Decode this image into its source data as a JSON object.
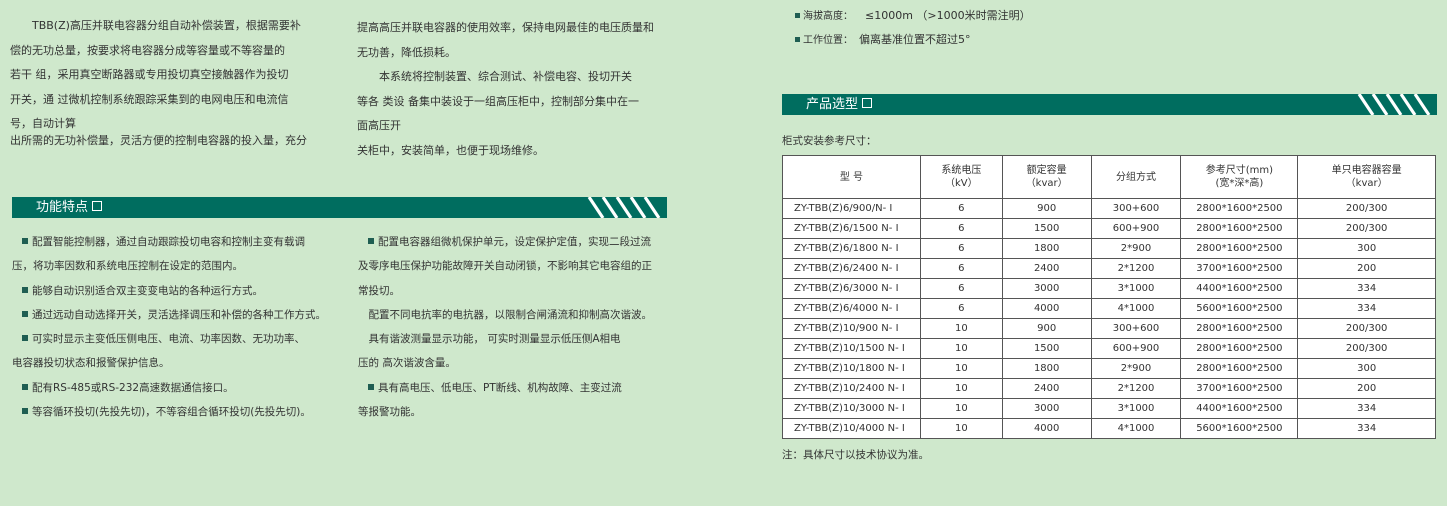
{
  "intro_left": [
    "　　TBB(Z)高压并联电容器分组自动补偿装置，根据需要补",
    "偿的无功总量，按要求将电容器分成等容量或不等容量的",
    "若干 组，采用真空断路器或专用投切真空接触器作为投切",
    "开关，通 过微机控制系统跟踪采集到的电网电压和电流信",
    "号，自动计算",
    "出所需的无功补偿量，灵活方便的控制电容器的投入量，充分"
  ],
  "intro_right": [
    "提高高压并联电容器的使用效率，保持电网最佳的电压质量和",
    "无功善，降低损耗。",
    "　　本系统将控制装置、综合测试、补偿电容、投切开关",
    "等各 类设 备集中装设于一组高压柜中，控制部分集中在一",
    "面高压开",
    "关柜中，安装简单，也便于现场维修。"
  ],
  "env": [
    {
      "label": "海拔高度：",
      "value": "≤1000m （>1000米时需注明）"
    },
    {
      "label": "工作位置：",
      "value": "偏离基准位置不超过5°"
    }
  ],
  "features_banner": {
    "title": "功能特点"
  },
  "features_left": [
    {
      "bullet": true,
      "text": "配置智能控制器，通过自动跟踪投切电容和控制主变有载调"
    },
    {
      "bullet": false,
      "text": "压，将功率因数和系统电压控制在设定的范围内。"
    },
    {
      "bullet": true,
      "text": "能够自动识别适合双主变变电站的各种运行方式。"
    },
    {
      "bullet": true,
      "text": "通过远动自动选择开关，灵活选择调压和补偿的各种工作方式。"
    },
    {
      "bullet": true,
      "text": "可实时显示主变低压侧电压、电流、功率因数、无功功率、"
    },
    {
      "bullet": false,
      "text": "电容器投切状态和报警保护信息。"
    },
    {
      "bullet": true,
      "text": "配有RS-485或RS-232高速数据通信接口。"
    },
    {
      "bullet": true,
      "text": "等容循环投切(先投先切)，不等容组合循环投切(先投先切)。"
    }
  ],
  "features_right": [
    {
      "bullet": true,
      "text": "配置电容器组微机保护单元，设定保护定值，实现二段过流"
    },
    {
      "bullet": false,
      "text": "及零序电压保护功能故障开关自动闭锁，不影响其它电容组的正"
    },
    {
      "bullet": false,
      "text": "常投切。"
    },
    {
      "bullet": false,
      "text": "　配置不同电抗率的电抗器，以限制合闸涌流和抑制高次谐波。"
    },
    {
      "bullet": false,
      "text": "　具有谐波测量显示功能，  可实时测量显示低压侧A相电"
    },
    {
      "bullet": false,
      "text": "压的 高次谐波含量。"
    },
    {
      "bullet": true,
      "text": "具有高电压、低电压、PT断线、机构故障、主变过流"
    },
    {
      "bullet": false,
      "text": "等报警功能。"
    }
  ],
  "selection_banner": {
    "title": "产品选型"
  },
  "table_caption": "柜式安装参考尺寸：",
  "table": {
    "headers": [
      {
        "line1": "型 号",
        "line2": ""
      },
      {
        "line1": "系统电压",
        "line2": "（kV）"
      },
      {
        "line1": "额定容量",
        "line2": "（kvar）"
      },
      {
        "line1": "分组方式",
        "line2": ""
      },
      {
        "line1": "参考尺寸(mm)",
        "line2": "(宽*深*高)"
      },
      {
        "line1": "单只电容器容量",
        "line2": "（kvar）"
      }
    ],
    "rows": [
      [
        "ZY-TBB(Z)6/900/N-  I",
        "6",
        "900",
        "300+600",
        "2800*1600*2500",
        "200/300"
      ],
      [
        "ZY-TBB(Z)6/1500  N-  I",
        "6",
        "1500",
        "600+900",
        "2800*1600*2500",
        "200/300"
      ],
      [
        "ZY-TBB(Z)6/1800  N-  I",
        "6",
        "1800",
        "2*900",
        "2800*1600*2500",
        "300"
      ],
      [
        "ZY-TBB(Z)6/2400  N-  I",
        "6",
        "2400",
        "2*1200",
        "3700*1600*2500",
        "200"
      ],
      [
        "ZY-TBB(Z)6/3000  N-  I",
        "6",
        "3000",
        "3*1000",
        "4400*1600*2500",
        "334"
      ],
      [
        "ZY-TBB(Z)6/4000  N-  I",
        "6",
        "4000",
        "4*1000",
        "5600*1600*2500",
        "334"
      ],
      [
        "ZY-TBB(Z)10/900  N-  I",
        "10",
        "900",
        "300+600",
        "2800*1600*2500",
        "200/300"
      ],
      [
        "ZY-TBB(Z)10/1500  N-  I",
        "10",
        "1500",
        "600+900",
        "2800*1600*2500",
        "200/300"
      ],
      [
        "ZY-TBB(Z)10/1800  N-  I",
        "10",
        "1800",
        "2*900",
        "2800*1600*2500",
        "300"
      ],
      [
        "ZY-TBB(Z)10/2400  N-  I",
        "10",
        "2400",
        "2*1200",
        "3700*1600*2500",
        "200"
      ],
      [
        "ZY-TBB(Z)10/3000  N-  I",
        "10",
        "3000",
        "3*1000",
        "4400*1600*2500",
        "334"
      ],
      [
        "ZY-TBB(Z)10/4000  N-  I",
        "10",
        "4000",
        "4*1000",
        "5600*1600*2500",
        "334"
      ]
    ]
  },
  "note": "注：具体尺寸以技术协议为准。",
  "colors": {
    "background": "#cfe8cc",
    "banner": "#006d5f",
    "bullet": "#1f5e52"
  }
}
